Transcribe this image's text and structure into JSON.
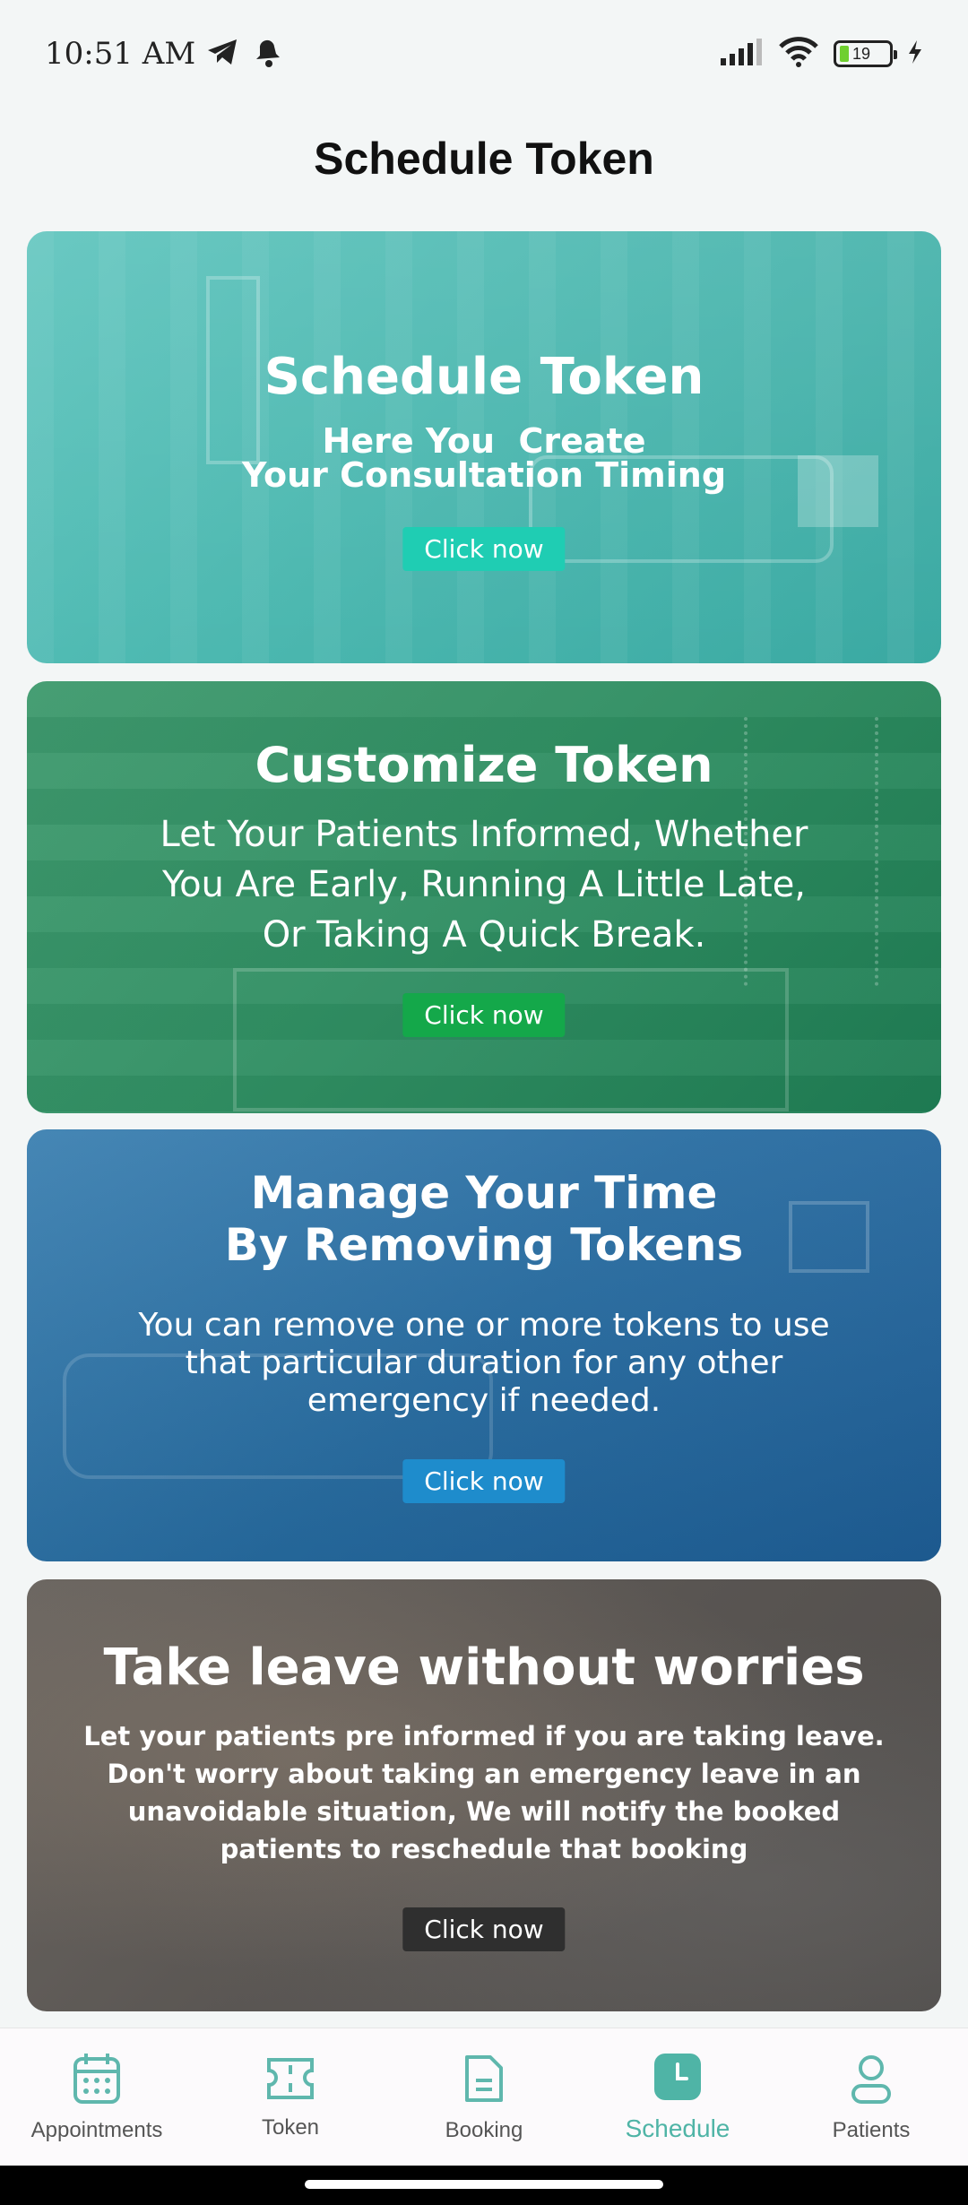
{
  "status": {
    "time": "10:51 AM",
    "battery": "19"
  },
  "header": {
    "title": "Schedule Token"
  },
  "cards": [
    {
      "title": "Schedule Token",
      "subtitle_line1": "Here You  Create",
      "subtitle_line2": "Your Consultation Timing",
      "cta": "Click now",
      "cta_color": "#1fcdb3"
    },
    {
      "title": "Customize Token",
      "line1": "Let Your Patients Informed, Whether",
      "line2": "You Are Early, Running A Little Late,",
      "line3": "Or Taking A Quick Break.",
      "cta": "Click now",
      "cta_color": "#14a84a"
    },
    {
      "title_line1": "Manage Your Time",
      "title_line2": "By Removing Tokens",
      "line1": "You can remove one or more tokens to use",
      "line2": "that particular duration for any other",
      "line3": "emergency if needed.",
      "cta": "Click now",
      "cta_color": "#1e8ccc"
    },
    {
      "title": "Take leave without worries",
      "line1": "Let your patients pre informed if you are taking leave.",
      "line2": "Don't worry about taking an emergency leave in an",
      "line3": "unavoidable situation, We will notify the booked",
      "line4": "patients to reschedule that booking",
      "cta": "Click now",
      "cta_color": "#2f2f2f"
    }
  ],
  "nav": {
    "items": [
      {
        "label": "Appointments",
        "icon": "calendar-icon"
      },
      {
        "label": "Token",
        "icon": "ticket-icon"
      },
      {
        "label": "Booking",
        "icon": "document-icon"
      },
      {
        "label": "Schedule",
        "icon": "clock-icon",
        "active": true
      },
      {
        "label": "Patients",
        "icon": "person-icon"
      }
    ],
    "accent_color": "#4fb4a6",
    "inactive_color": "#5fb7ad"
  }
}
